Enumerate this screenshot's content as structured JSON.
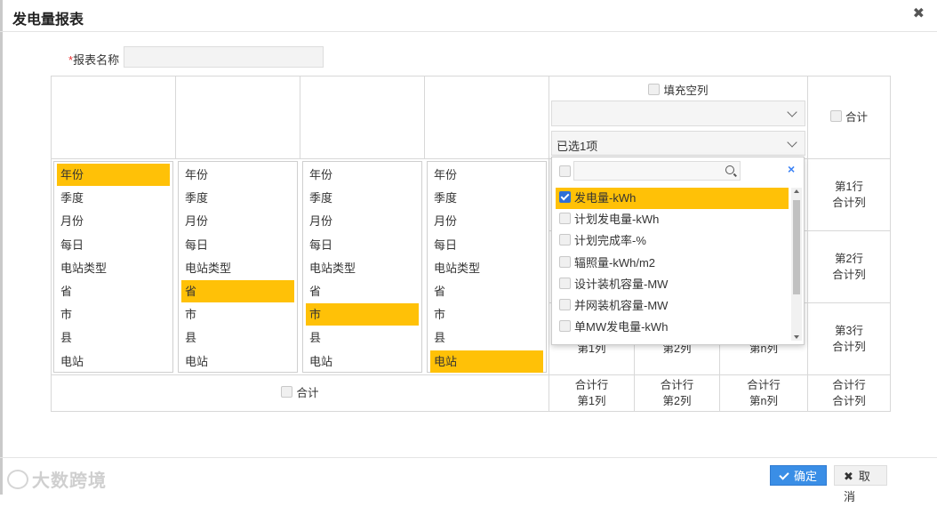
{
  "dialog": {
    "title": "发电量报表",
    "close_symbol": "✖"
  },
  "form": {
    "required_mark": "*",
    "name_label": "报表名称",
    "name_value": ""
  },
  "header": {
    "fill_empty_label": "填充空列",
    "total_label": "合计",
    "select1_value": "",
    "select2_value": "已选1项"
  },
  "dimension_items": [
    "年份",
    "季度",
    "月份",
    "每日",
    "电站类型",
    "省",
    "市",
    "县",
    "电站"
  ],
  "lists": [
    {
      "selected": "年份"
    },
    {
      "selected": "省"
    },
    {
      "selected": "市"
    },
    {
      "selected": "电站"
    }
  ],
  "dropdown": {
    "search_value": "",
    "clear_symbol": "×",
    "options": [
      {
        "label": "发电量-kWh",
        "checked": true
      },
      {
        "label": "计划发电量-kWh",
        "checked": false
      },
      {
        "label": "计划完成率-%",
        "checked": false
      },
      {
        "label": "辐照量-kWh/m2",
        "checked": false
      },
      {
        "label": "设计装机容量-MW",
        "checked": false
      },
      {
        "label": "并网装机容量-MW",
        "checked": false
      },
      {
        "label": "单MW发电量-kWh",
        "checked": false
      }
    ]
  },
  "right_col": {
    "row1": [
      "第1行",
      "合计列"
    ],
    "row2": [
      "第2行",
      "合计列"
    ],
    "row3": [
      "第3行",
      "合计列"
    ]
  },
  "partial_row3": [
    "第1列",
    "第2列",
    "第n列"
  ],
  "bottom_row": {
    "total_label": "合计",
    "cells": [
      [
        "合计行",
        "第1列"
      ],
      [
        "合计行",
        "第2列"
      ],
      [
        "合计行",
        "第n列"
      ],
      [
        "合计行",
        "合计列"
      ]
    ]
  },
  "footer": {
    "ok_label": "确定",
    "cancel_label": "取消",
    "watermark": "大数跨境"
  },
  "colors": {
    "selected": "#ffc107",
    "primary": "#3a8ee6"
  }
}
